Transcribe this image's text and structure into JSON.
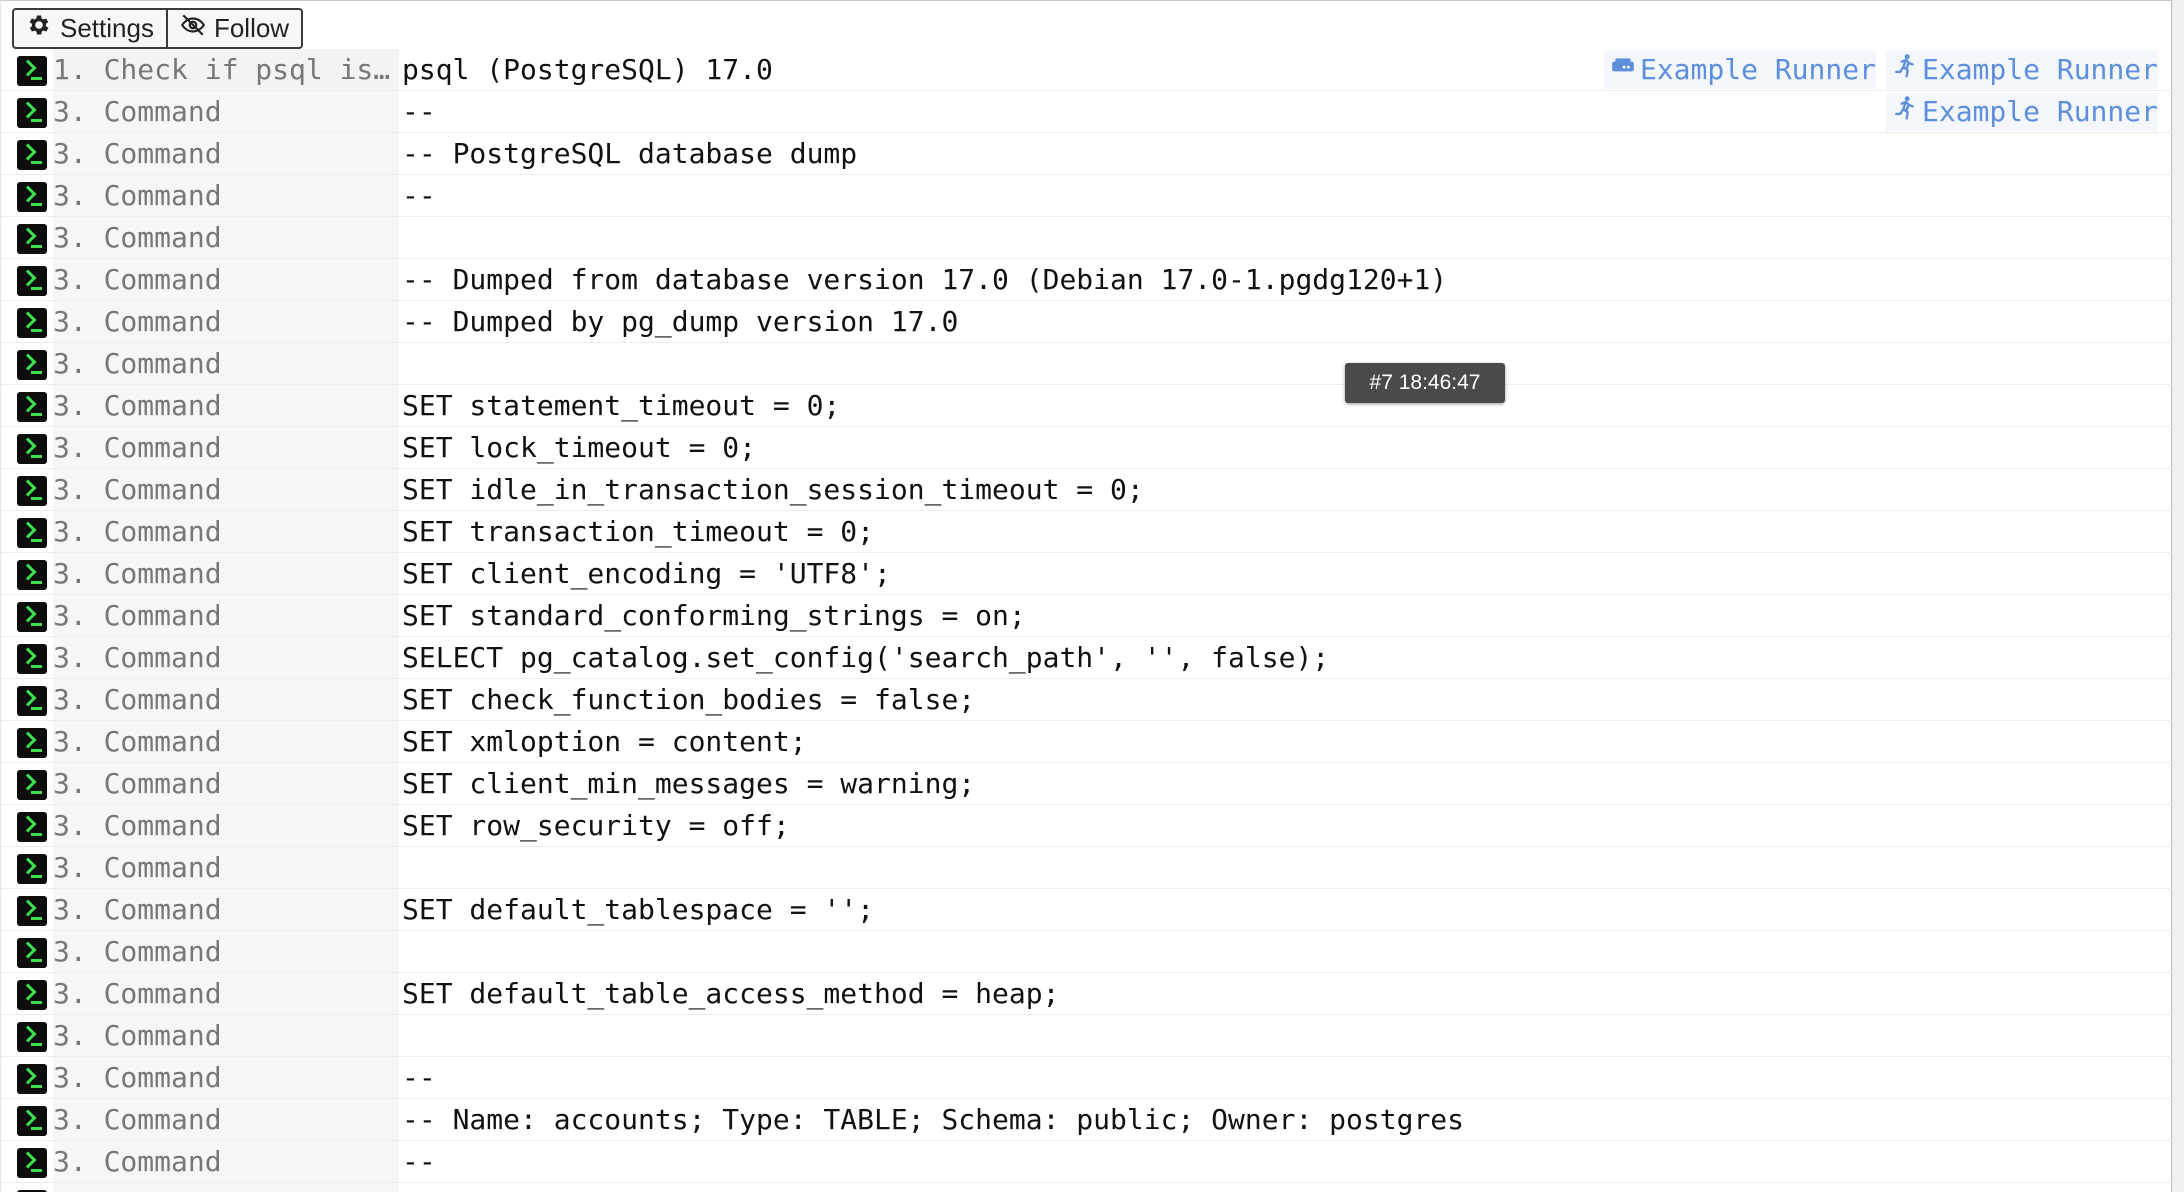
{
  "toolbar": {
    "settings_label": "Settings",
    "follow_label": "Follow"
  },
  "tooltip": "#7 18:46:47",
  "runner_label": "Example Runner",
  "rows": [
    {
      "step": "1. Check if psql is…",
      "text": "psql (PostgreSQL) 17.0",
      "runners": [
        "server-icon",
        "running-person-icon"
      ]
    },
    {
      "step": "3. Command",
      "text": "--",
      "runners": [
        "running-person-icon"
      ]
    },
    {
      "step": "3. Command",
      "text": "-- PostgreSQL database dump"
    },
    {
      "step": "3. Command",
      "text": "--"
    },
    {
      "step": "3. Command",
      "text": ""
    },
    {
      "step": "3. Command",
      "text": "-- Dumped from database version 17.0 (Debian 17.0-1.pgdg120+1)"
    },
    {
      "step": "3. Command",
      "text": "-- Dumped by pg_dump version 17.0"
    },
    {
      "step": "3. Command",
      "text": ""
    },
    {
      "step": "3. Command",
      "text": "SET statement_timeout = 0;"
    },
    {
      "step": "3. Command",
      "text": "SET lock_timeout = 0;"
    },
    {
      "step": "3. Command",
      "text": "SET idle_in_transaction_session_timeout = 0;"
    },
    {
      "step": "3. Command",
      "text": "SET transaction_timeout = 0;"
    },
    {
      "step": "3. Command",
      "text": "SET client_encoding = 'UTF8';"
    },
    {
      "step": "3. Command",
      "text": "SET standard_conforming_strings = on;"
    },
    {
      "step": "3. Command",
      "text": "SELECT pg_catalog.set_config('search_path', '', false);"
    },
    {
      "step": "3. Command",
      "text": "SET check_function_bodies = false;"
    },
    {
      "step": "3. Command",
      "text": "SET xmloption = content;"
    },
    {
      "step": "3. Command",
      "text": "SET client_min_messages = warning;"
    },
    {
      "step": "3. Command",
      "text": "SET row_security = off;"
    },
    {
      "step": "3. Command",
      "text": ""
    },
    {
      "step": "3. Command",
      "text": "SET default_tablespace = '';"
    },
    {
      "step": "3. Command",
      "text": ""
    },
    {
      "step": "3. Command",
      "text": "SET default_table_access_method = heap;"
    },
    {
      "step": "3. Command",
      "text": ""
    },
    {
      "step": "3. Command",
      "text": "--"
    },
    {
      "step": "3. Command",
      "text": "-- Name: accounts; Type: TABLE; Schema: public; Owner: postgres"
    },
    {
      "step": "3. Command",
      "text": "--"
    },
    {
      "step": "3. Command",
      "text": ""
    }
  ]
}
